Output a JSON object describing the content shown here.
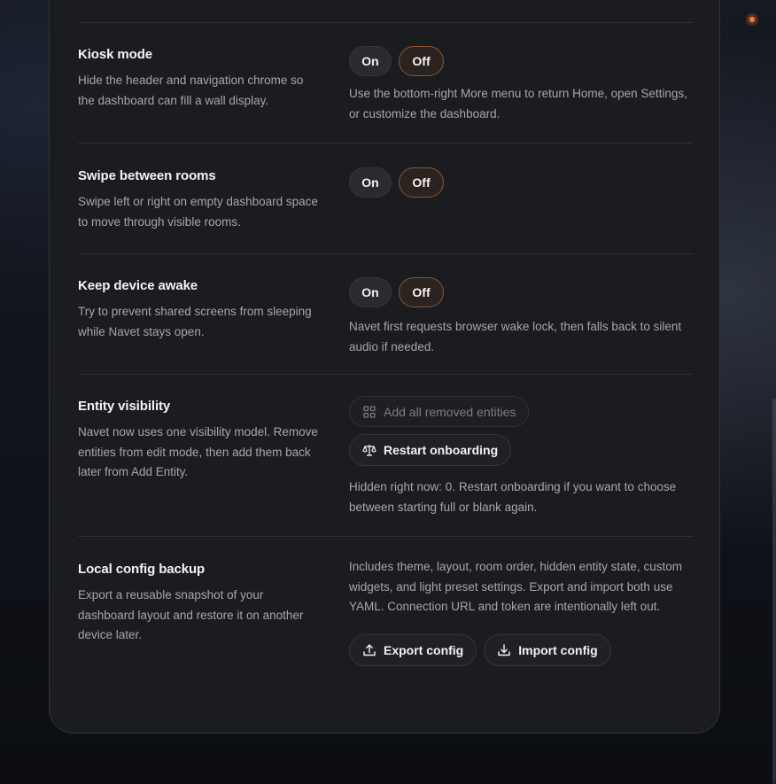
{
  "settings": {
    "kiosk": {
      "title": "Kiosk mode",
      "description": "Hide the header and navigation chrome so the dashboard can fill a wall display.",
      "on_label": "On",
      "off_label": "Off",
      "selected": "Off",
      "note": "Use the bottom-right More menu to return Home, open Settings, or customize the dashboard."
    },
    "swipe": {
      "title": "Swipe between rooms",
      "description": "Swipe left or right on empty dashboard space to move through visible rooms.",
      "on_label": "On",
      "off_label": "Off",
      "selected": "Off"
    },
    "awake": {
      "title": "Keep device awake",
      "description": "Try to prevent shared screens from sleeping while Navet stays open.",
      "on_label": "On",
      "off_label": "Off",
      "selected": "Off",
      "note": "Navet first requests browser wake lock, then falls back to silent audio if needed."
    },
    "visibility": {
      "title": "Entity visibility",
      "description": "Navet now uses one visibility model. Remove entities from edit mode, then add them back later from Add Entity.",
      "add_all_label": "Add all removed entities",
      "restart_label": "Restart onboarding",
      "note": "Hidden right now: 0. Restart onboarding if you want to choose between starting full or blank again."
    },
    "backup": {
      "title": "Local config backup",
      "description": "Export a reusable snapshot of your dashboard layout and restore it on another device later.",
      "note": "Includes theme, layout, room order, hidden entity state, custom widgets, and light preset settings. Export and import both use YAML. Connection URL and token are intentionally left out.",
      "export_label": "Export config",
      "import_label": "Import config"
    }
  },
  "icons": {
    "add_all": "grid-icon",
    "restart": "scale-icon",
    "export": "upload-icon",
    "import": "download-icon"
  },
  "colors": {
    "accent": "#8a5634",
    "status_dot": "#f07a3a",
    "panel": "#1b1c1f"
  }
}
